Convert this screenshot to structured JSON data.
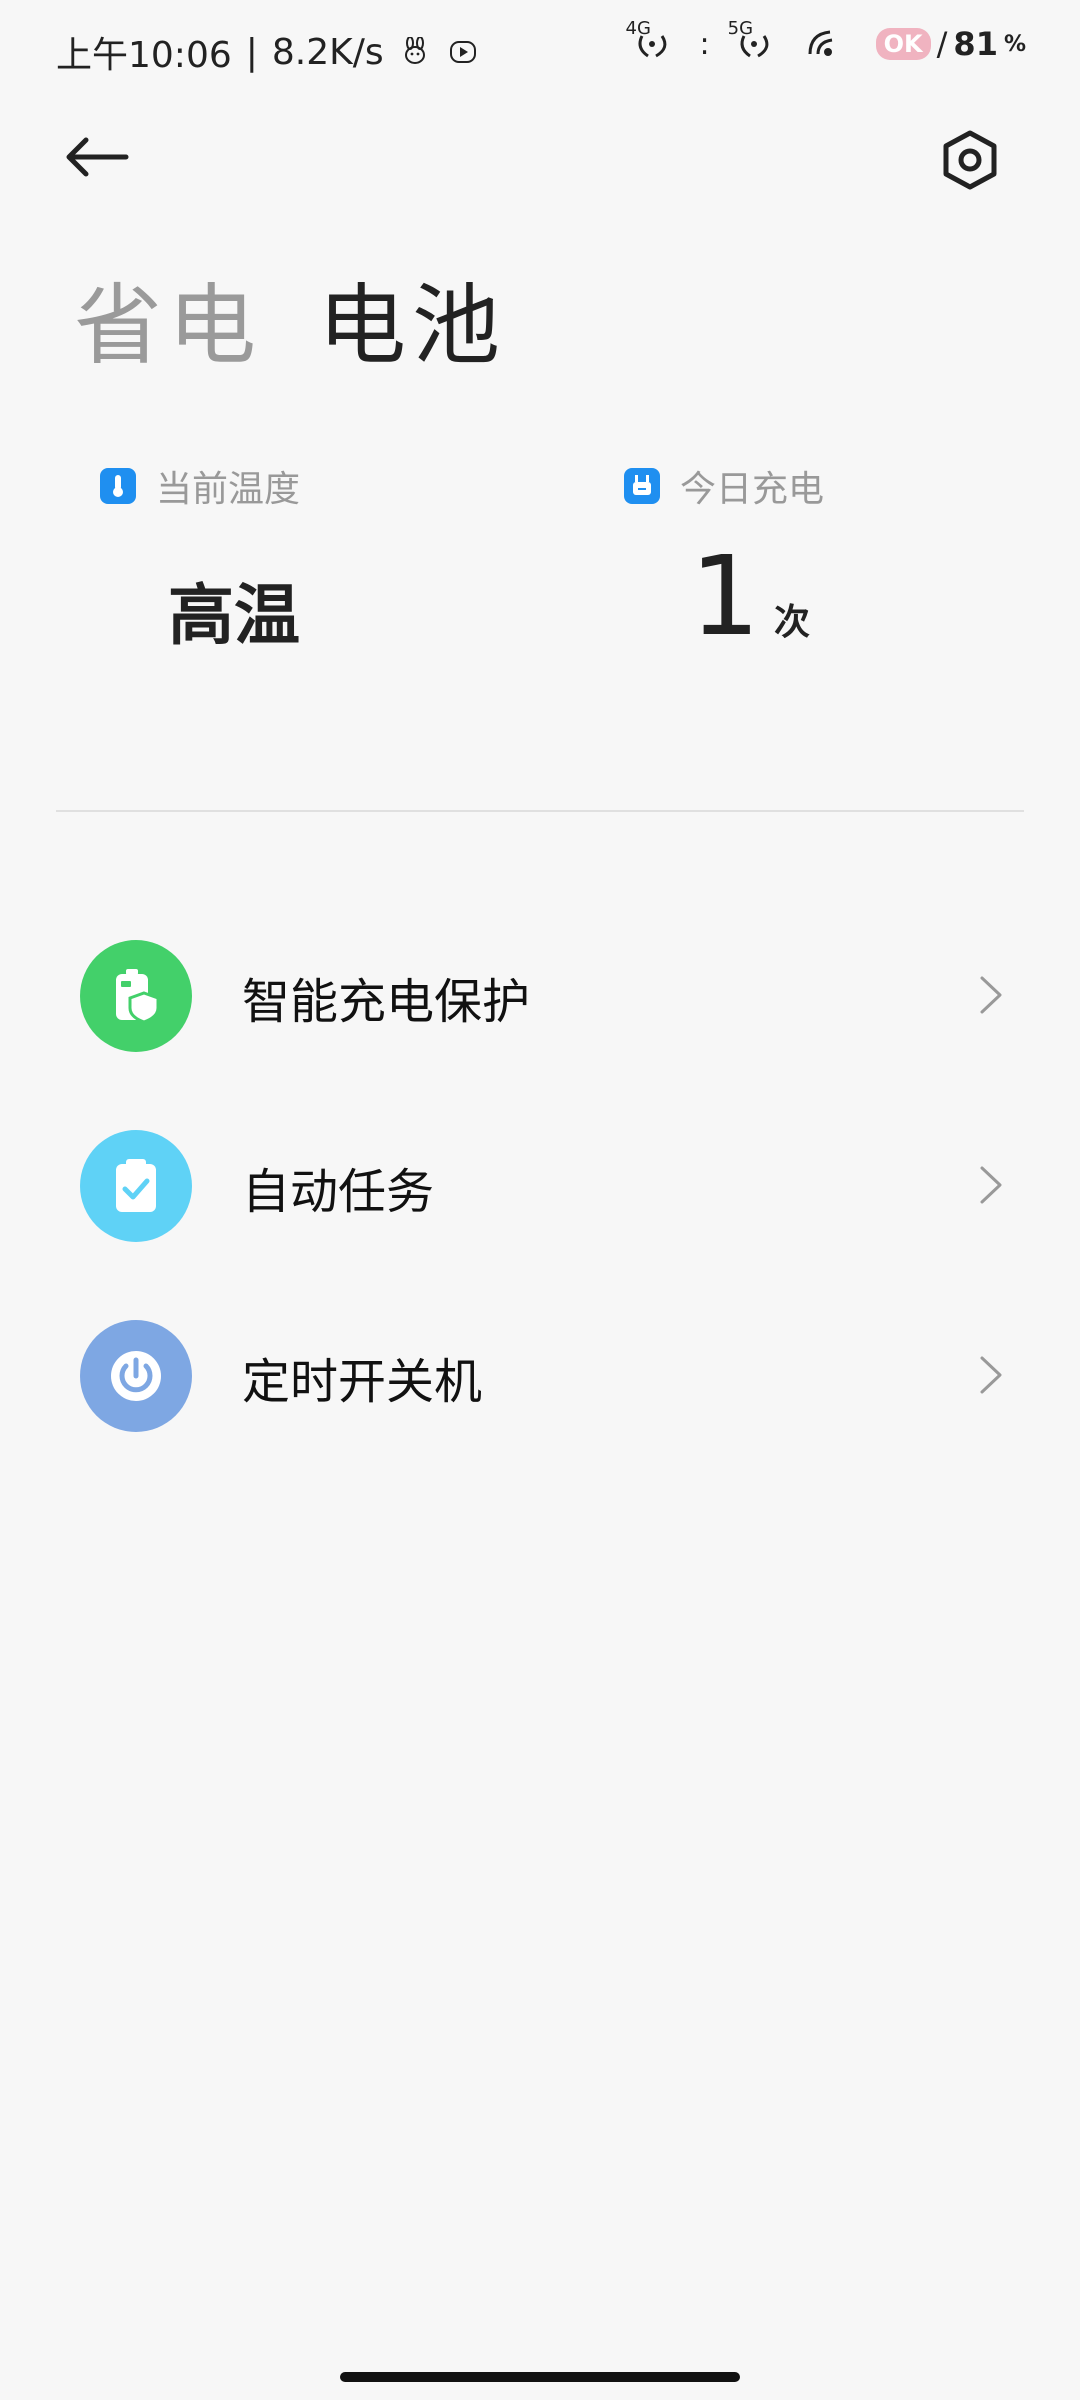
{
  "status_bar": {
    "time": "上午10:06",
    "separator": "|",
    "net_speed": "8.2K/s",
    "signal1_label": "4G",
    "signal2_label": "5G",
    "ok_badge": "OK",
    "battery_percent": "81",
    "battery_unit": "%"
  },
  "nav": {
    "back_icon": "arrow-left-icon",
    "settings_icon": "hexagon-settings-icon"
  },
  "tabs": [
    {
      "label": "省电",
      "active": false
    },
    {
      "label": "电池",
      "active": true
    }
  ],
  "stats": {
    "temperature": {
      "label": "当前温度",
      "value": "高温",
      "icon": "thermometer-icon"
    },
    "charge_today": {
      "label": "今日充电",
      "value": "1",
      "unit": "次",
      "icon": "plug-icon"
    }
  },
  "menu": [
    {
      "label": "智能充电保护",
      "icon": "battery-shield-icon",
      "color": "#43d06a"
    },
    {
      "label": "自动任务",
      "icon": "clipboard-check-icon",
      "color": "#5fd2f6"
    },
    {
      "label": "定时开关机",
      "icon": "power-icon",
      "color": "#7ea7e3"
    }
  ],
  "colors": {
    "accent_blue": "#1f8ff0",
    "background": "#f7f7f7"
  }
}
